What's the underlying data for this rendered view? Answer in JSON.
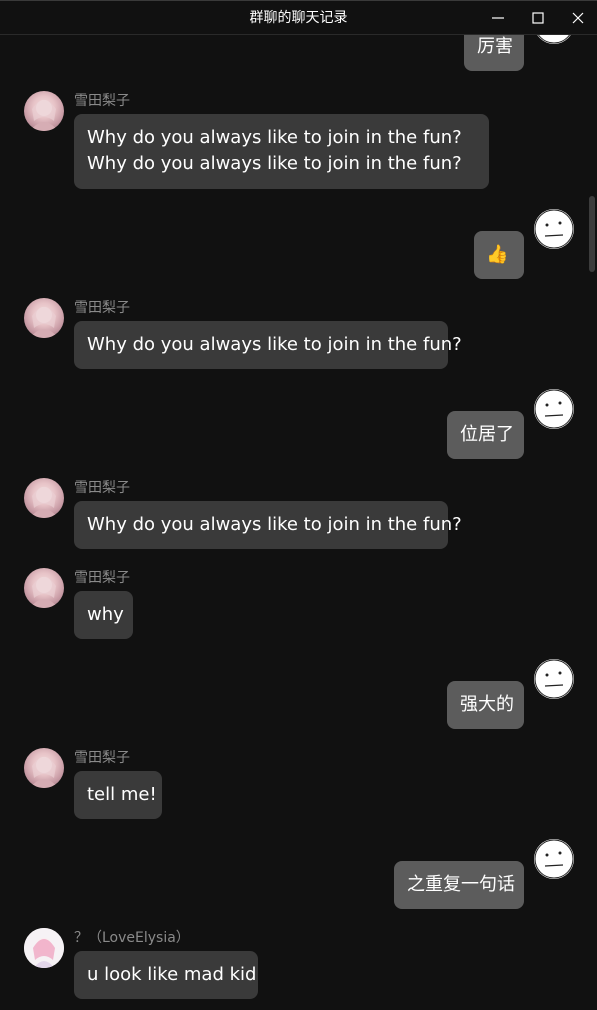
{
  "window": {
    "title": "群聊的聊天记录",
    "minimize_icon": "minimize-icon",
    "maximize_icon": "maximize-icon",
    "close_icon": "close-icon"
  },
  "colors": {
    "background": "#111111",
    "incoming_bubble": "#3a3a3a",
    "outgoing_bubble": "#5c5c5c",
    "sender_name": "#8a8a8a"
  },
  "messages": [
    {
      "side": "out",
      "text": "厉害"
    },
    {
      "side": "in",
      "sender": "雪田梨子",
      "text": "Why do you always like to join in the fun?Why do you always like to join in the fun?"
    },
    {
      "side": "out",
      "text": "👍"
    },
    {
      "side": "in",
      "sender": "雪田梨子",
      "text": "Why do you always like to join in the fun?"
    },
    {
      "side": "out",
      "text": "位居了"
    },
    {
      "side": "in",
      "sender": "雪田梨子",
      "text": "Why do you always like to join in the fun?"
    },
    {
      "side": "in",
      "sender": "雪田梨子",
      "text": "why"
    },
    {
      "side": "out",
      "text": "强大的"
    },
    {
      "side": "in",
      "sender": "雪田梨子",
      "text": "tell me!"
    },
    {
      "side": "out",
      "text": "之重复一句话"
    },
    {
      "side": "in",
      "sender": "？（LoveElysia）",
      "text": "u look like mad kid"
    }
  ]
}
